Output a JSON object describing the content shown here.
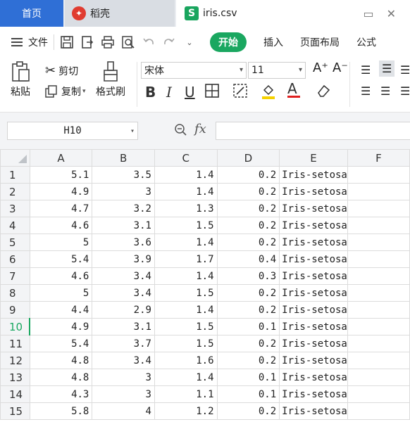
{
  "tabs": {
    "home": "首页",
    "docer": "稻壳",
    "file": "iris.csv"
  },
  "menubar": {
    "file_label": "文件",
    "start_label": "开始",
    "items": [
      "插入",
      "页面布局",
      "公式"
    ]
  },
  "ribbon": {
    "paste": "粘贴",
    "cut": "剪切",
    "copy": "复制",
    "format_painter": "格式刷",
    "font_name": "宋体",
    "font_size": "11"
  },
  "formula_bar": {
    "cell_ref": "H10",
    "fx": "fx",
    "content": ""
  },
  "grid": {
    "columns": [
      "A",
      "B",
      "C",
      "D",
      "E",
      "F"
    ],
    "active_row": 10,
    "rows": [
      {
        "n": "1",
        "cells": [
          "5.1",
          "3.5",
          "1.4",
          "0.2",
          "Iris-setosa"
        ]
      },
      {
        "n": "2",
        "cells": [
          "4.9",
          "3",
          "1.4",
          "0.2",
          "Iris-setosa"
        ]
      },
      {
        "n": "3",
        "cells": [
          "4.7",
          "3.2",
          "1.3",
          "0.2",
          "Iris-setosa"
        ]
      },
      {
        "n": "4",
        "cells": [
          "4.6",
          "3.1",
          "1.5",
          "0.2",
          "Iris-setosa"
        ]
      },
      {
        "n": "5",
        "cells": [
          "5",
          "3.6",
          "1.4",
          "0.2",
          "Iris-setosa"
        ]
      },
      {
        "n": "6",
        "cells": [
          "5.4",
          "3.9",
          "1.7",
          "0.4",
          "Iris-setosa"
        ]
      },
      {
        "n": "7",
        "cells": [
          "4.6",
          "3.4",
          "1.4",
          "0.3",
          "Iris-setosa"
        ]
      },
      {
        "n": "8",
        "cells": [
          "5",
          "3.4",
          "1.5",
          "0.2",
          "Iris-setosa"
        ]
      },
      {
        "n": "9",
        "cells": [
          "4.4",
          "2.9",
          "1.4",
          "0.2",
          "Iris-setosa"
        ]
      },
      {
        "n": "10",
        "cells": [
          "4.9",
          "3.1",
          "1.5",
          "0.1",
          "Iris-setosa"
        ]
      },
      {
        "n": "11",
        "cells": [
          "5.4",
          "3.7",
          "1.5",
          "0.2",
          "Iris-setosa"
        ]
      },
      {
        "n": "12",
        "cells": [
          "4.8",
          "3.4",
          "1.6",
          "0.2",
          "Iris-setosa"
        ]
      },
      {
        "n": "13",
        "cells": [
          "4.8",
          "3",
          "1.4",
          "0.1",
          "Iris-setosa"
        ]
      },
      {
        "n": "14",
        "cells": [
          "4.3",
          "3",
          "1.1",
          "0.1",
          "Iris-setosa"
        ]
      },
      {
        "n": "15",
        "cells": [
          "5.8",
          "4",
          "1.2",
          "0.2",
          "Iris-setosa"
        ]
      }
    ]
  },
  "colors": {
    "home_tab": "#2f6fd6",
    "accent_green": "#1aa760",
    "docer_red": "#e03c30"
  }
}
